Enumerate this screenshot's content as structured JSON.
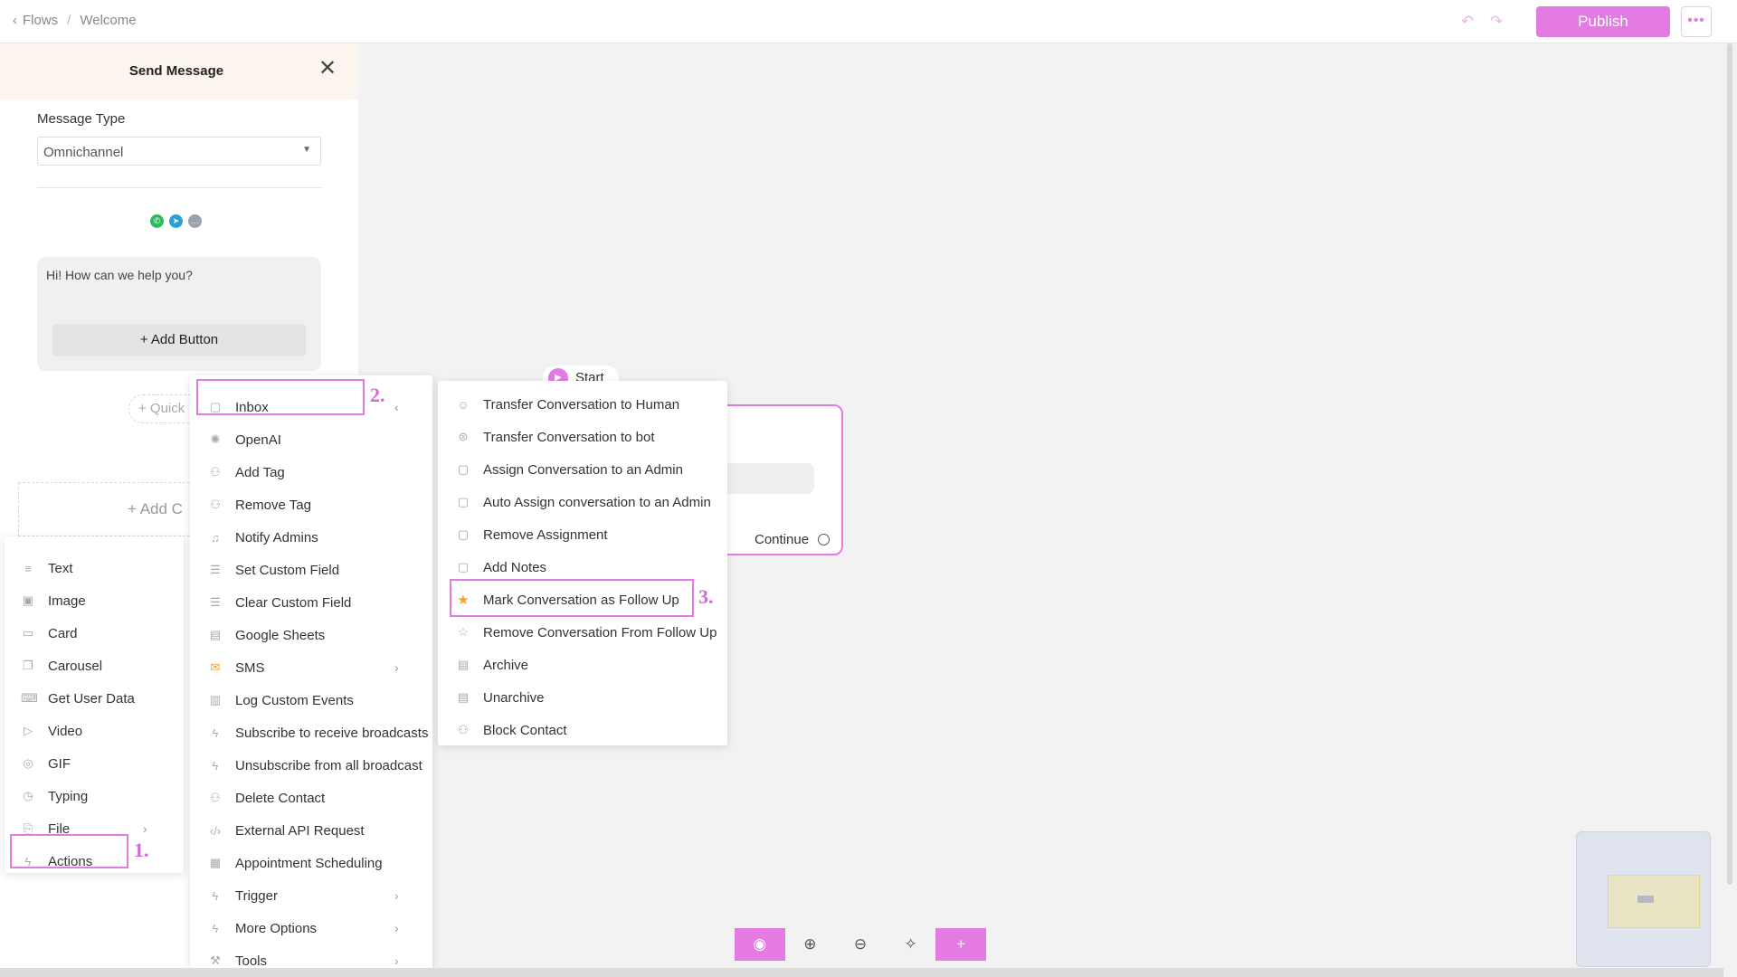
{
  "breadcrumb": {
    "parent": "Flows",
    "current": "Welcome"
  },
  "topbar": {
    "undo_icon": "↶",
    "redo_icon": "↷",
    "publish_label": "Publish",
    "more_icon": "•••"
  },
  "panel": {
    "title": "Send Message",
    "close_icon": "✕",
    "message_type_label": "Message Type",
    "message_type_value": "Omnichannel",
    "channels": [
      {
        "name": "whatsapp",
        "glyph": "✆",
        "color": "#25c05e"
      },
      {
        "name": "telegram",
        "glyph": "➤",
        "color": "#2a9fd8"
      },
      {
        "name": "chat",
        "glyph": "…",
        "color": "#9aa3ad"
      }
    ],
    "message_text": "Hi! How can we help you?",
    "add_button_label": "+ Add Button",
    "quick_label": "+ Quick",
    "add_content_label": "+ Add C"
  },
  "menu1": {
    "items": [
      {
        "label": "Text",
        "icon": "≡"
      },
      {
        "label": "Image",
        "icon": "▣"
      },
      {
        "label": "Card",
        "icon": "▭"
      },
      {
        "label": "Carousel",
        "icon": "❐"
      },
      {
        "label": "Get User Data",
        "icon": "⌨"
      },
      {
        "label": "Video",
        "icon": "▷"
      },
      {
        "label": "GIF",
        "icon": "◎"
      },
      {
        "label": "Typing",
        "icon": "◷"
      },
      {
        "label": "File",
        "icon": "⎘",
        "arrow": "›"
      },
      {
        "label": "Actions",
        "icon": "ϟ"
      }
    ],
    "step": "1."
  },
  "menu2": {
    "items": [
      {
        "label": "Inbox",
        "icon": "▢",
        "arrow": "‹"
      },
      {
        "label": "OpenAI",
        "icon": "✺"
      },
      {
        "label": "Add Tag",
        "icon": "⚇"
      },
      {
        "label": "Remove Tag",
        "icon": "⚇"
      },
      {
        "label": "Notify Admins",
        "icon": "♫"
      },
      {
        "label": "Set Custom Field",
        "icon": "☰"
      },
      {
        "label": "Clear Custom Field",
        "icon": "☰"
      },
      {
        "label": "Google Sheets",
        "icon": "▤"
      },
      {
        "label": "SMS",
        "icon": "✉",
        "arrow": "›"
      },
      {
        "label": "Log Custom Events",
        "icon": "▥"
      },
      {
        "label": "Subscribe to receive broadcasts",
        "icon": "ϟ"
      },
      {
        "label": "Unsubscribe from all broadcast",
        "icon": "ϟ"
      },
      {
        "label": "Delete Contact",
        "icon": "⚇"
      },
      {
        "label": "External API Request",
        "icon": "‹/›"
      },
      {
        "label": "Appointment Scheduling",
        "icon": "▦"
      },
      {
        "label": "Trigger",
        "icon": "ϟ",
        "arrow": "›"
      },
      {
        "label": "More Options",
        "icon": "ϟ",
        "arrow": "›"
      },
      {
        "label": "Tools",
        "icon": "⚒",
        "arrow": "›"
      }
    ],
    "step": "2."
  },
  "menu3": {
    "items": [
      {
        "label": "Transfer Conversation to Human",
        "icon": "☺"
      },
      {
        "label": "Transfer Conversation to bot",
        "icon": "⊜"
      },
      {
        "label": "Assign Conversation to an Admin",
        "icon": "▢"
      },
      {
        "label": "Auto Assign conversation to an Admin",
        "icon": "▢"
      },
      {
        "label": "Remove Assignment",
        "icon": "▢"
      },
      {
        "label": "Add Notes",
        "icon": "▢"
      },
      {
        "label": "Mark Conversation as Follow Up",
        "icon": "★"
      },
      {
        "label": "Remove Conversation From Follow Up",
        "icon": "☆"
      },
      {
        "label": "Archive",
        "icon": "▤"
      },
      {
        "label": "Unarchive",
        "icon": "▤"
      },
      {
        "label": "Block Contact",
        "icon": "⚇"
      }
    ],
    "step": "3."
  },
  "canvas": {
    "start_label": "Start",
    "continue_label": "Continue"
  },
  "toolbar": {
    "items": [
      {
        "name": "preview-icon",
        "glyph": "◉"
      },
      {
        "name": "zoom-in-icon",
        "glyph": "⊕"
      },
      {
        "name": "zoom-out-icon",
        "glyph": "⊖"
      },
      {
        "name": "auto-arrange-icon",
        "glyph": "✧"
      },
      {
        "name": "add-icon",
        "glyph": "+"
      }
    ]
  },
  "colors": {
    "accent": "#e37be3",
    "highlight_step": "#d468d4",
    "star": "#f5a623",
    "sms": "#f0a030"
  }
}
